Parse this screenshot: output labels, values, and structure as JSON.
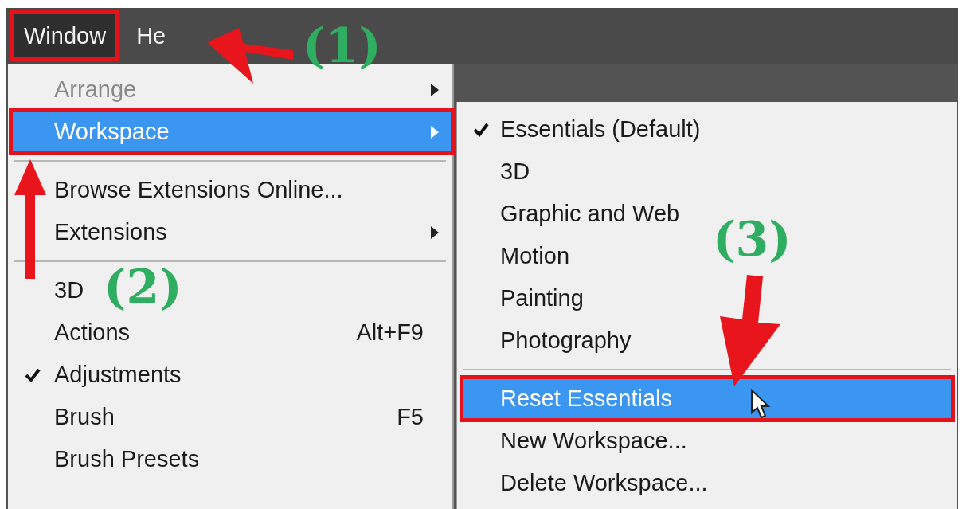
{
  "menu_bar": [
    {
      "label": "Window",
      "selected": true,
      "annotated": true
    },
    {
      "label": "He",
      "selected": false,
      "annotated": false
    }
  ],
  "window_menu": [
    {
      "kind": "item",
      "label": "Arrange",
      "disabled": true,
      "checked": false,
      "selected": false,
      "annotated": false,
      "submenu": true
    },
    {
      "kind": "item",
      "label": "Workspace",
      "disabled": false,
      "checked": false,
      "selected": true,
      "annotated": true,
      "submenu": true
    },
    {
      "kind": "separator"
    },
    {
      "kind": "item",
      "label": "Browse Extensions Online...",
      "disabled": false,
      "checked": false,
      "selected": false,
      "annotated": false,
      "submenu": false
    },
    {
      "kind": "item",
      "label": "Extensions",
      "disabled": false,
      "checked": false,
      "selected": false,
      "annotated": false,
      "submenu": true
    },
    {
      "kind": "separator"
    },
    {
      "kind": "item",
      "label": "3D",
      "disabled": false,
      "checked": false,
      "selected": false,
      "annotated": false,
      "submenu": false
    },
    {
      "kind": "item",
      "label": "Actions",
      "shortcut": "Alt+F9",
      "disabled": false,
      "checked": false,
      "selected": false,
      "annotated": false,
      "submenu": false
    },
    {
      "kind": "item",
      "label": "Adjustments",
      "disabled": false,
      "checked": true,
      "selected": false,
      "annotated": false,
      "submenu": false
    },
    {
      "kind": "item",
      "label": "Brush",
      "shortcut": "F5",
      "disabled": false,
      "checked": false,
      "selected": false,
      "annotated": false,
      "submenu": false
    },
    {
      "kind": "item",
      "label": "Brush Presets",
      "disabled": false,
      "checked": false,
      "selected": false,
      "annotated": false,
      "submenu": false
    }
  ],
  "workspace_submenu": [
    {
      "kind": "item",
      "label": "Essentials (Default)",
      "checked": true,
      "selected": false,
      "annotated": false
    },
    {
      "kind": "item",
      "label": "3D",
      "checked": false,
      "selected": false,
      "annotated": false
    },
    {
      "kind": "item",
      "label": "Graphic and Web",
      "checked": false,
      "selected": false,
      "annotated": false
    },
    {
      "kind": "item",
      "label": "Motion",
      "checked": false,
      "selected": false,
      "annotated": false
    },
    {
      "kind": "item",
      "label": "Painting",
      "checked": false,
      "selected": false,
      "annotated": false
    },
    {
      "kind": "item",
      "label": "Photography",
      "checked": false,
      "selected": false,
      "annotated": false
    },
    {
      "kind": "separator"
    },
    {
      "kind": "item",
      "label": "Reset Essentials",
      "checked": false,
      "selected": true,
      "annotated": true
    },
    {
      "kind": "item",
      "label": "New Workspace...",
      "checked": false,
      "selected": false,
      "annotated": false
    },
    {
      "kind": "item",
      "label": "Delete Workspace...",
      "checked": false,
      "selected": false,
      "annotated": false
    }
  ],
  "annotations": [
    {
      "label": "(1)"
    },
    {
      "label": "(2)"
    },
    {
      "label": "(3)"
    }
  ]
}
